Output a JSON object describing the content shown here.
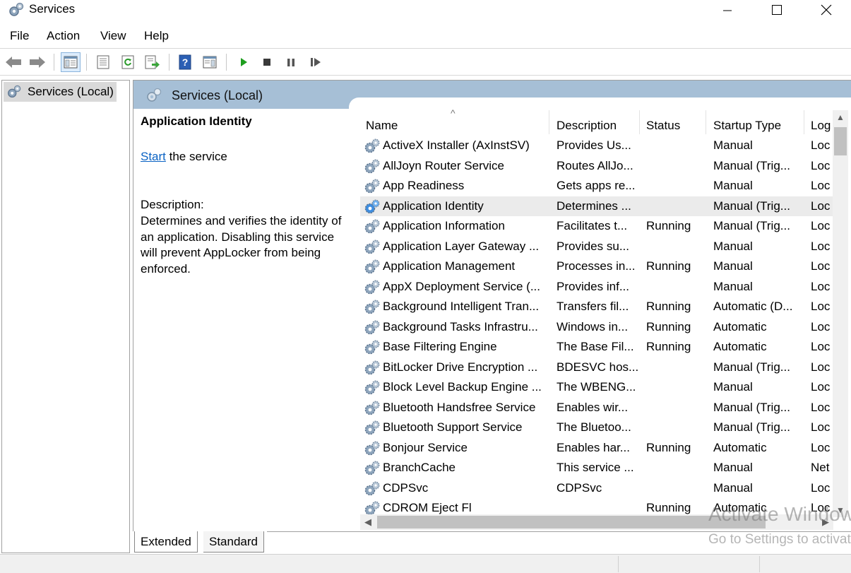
{
  "window": {
    "title": "Services"
  },
  "menu": [
    "File",
    "Action",
    "View",
    "Help"
  ],
  "tree": {
    "root_label": "Services (Local)"
  },
  "header": {
    "title": "Services (Local)"
  },
  "details": {
    "service_name": "Application Identity",
    "start_link": "Start",
    "start_suffix": " the service",
    "description_label": "Description:",
    "description_text": "Determines and verifies the identity of an application. Disabling this service will prevent AppLocker from being enforced."
  },
  "columns": {
    "name": "Name",
    "description": "Description",
    "status": "Status",
    "startup_type": "Startup Type",
    "log_on_as": "Log"
  },
  "services": [
    {
      "name": "ActiveX Installer (AxInstSV)",
      "description": "Provides Us...",
      "status": "",
      "startup": "Manual",
      "logon": "Loc"
    },
    {
      "name": "AllJoyn Router Service",
      "description": "Routes AllJo...",
      "status": "",
      "startup": "Manual (Trig...",
      "logon": "Loc"
    },
    {
      "name": "App Readiness",
      "description": "Gets apps re...",
      "status": "",
      "startup": "Manual",
      "logon": "Loc"
    },
    {
      "name": "Application Identity",
      "description": "Determines ...",
      "status": "",
      "startup": "Manual (Trig...",
      "logon": "Loc",
      "selected": true
    },
    {
      "name": "Application Information",
      "description": "Facilitates t...",
      "status": "Running",
      "startup": "Manual (Trig...",
      "logon": "Loc"
    },
    {
      "name": "Application Layer Gateway ...",
      "description": "Provides su...",
      "status": "",
      "startup": "Manual",
      "logon": "Loc"
    },
    {
      "name": "Application Management",
      "description": "Processes in...",
      "status": "Running",
      "startup": "Manual",
      "logon": "Loc"
    },
    {
      "name": "AppX Deployment Service (...",
      "description": "Provides inf...",
      "status": "",
      "startup": "Manual",
      "logon": "Loc"
    },
    {
      "name": "Background Intelligent Tran...",
      "description": "Transfers fil...",
      "status": "Running",
      "startup": "Automatic (D...",
      "logon": "Loc"
    },
    {
      "name": "Background Tasks Infrastru...",
      "description": "Windows in...",
      "status": "Running",
      "startup": "Automatic",
      "logon": "Loc"
    },
    {
      "name": "Base Filtering Engine",
      "description": "The Base Fil...",
      "status": "Running",
      "startup": "Automatic",
      "logon": "Loc"
    },
    {
      "name": "BitLocker Drive Encryption ...",
      "description": "BDESVC hos...",
      "status": "",
      "startup": "Manual (Trig...",
      "logon": "Loc"
    },
    {
      "name": "Block Level Backup Engine ...",
      "description": "The WBENG...",
      "status": "",
      "startup": "Manual",
      "logon": "Loc"
    },
    {
      "name": "Bluetooth Handsfree Service",
      "description": "Enables wir...",
      "status": "",
      "startup": "Manual (Trig...",
      "logon": "Loc"
    },
    {
      "name": "Bluetooth Support Service",
      "description": "The Bluetoo...",
      "status": "",
      "startup": "Manual (Trig...",
      "logon": "Loc"
    },
    {
      "name": "Bonjour Service",
      "description": "Enables har...",
      "status": "Running",
      "startup": "Automatic",
      "logon": "Loc"
    },
    {
      "name": "BranchCache",
      "description": "This service ...",
      "status": "",
      "startup": "Manual",
      "logon": "Net"
    },
    {
      "name": "CDPSvc",
      "description": "CDPSvc",
      "status": "",
      "startup": "Manual",
      "logon": "Loc"
    },
    {
      "name": "CDROM Eject Fl",
      "description": "",
      "status": "Running",
      "startup": "Automatic",
      "logon": "Loc"
    }
  ],
  "tabs": [
    "Extended",
    "Standard"
  ],
  "watermark": {
    "line1": "Activate Windows",
    "line2": "Go to Settings to activate Windows."
  },
  "colors": {
    "header_band": "#a6bfd6",
    "link": "#0b63c4",
    "play_green": "#1e9e1e",
    "help_blue": "#2b5fb4"
  }
}
